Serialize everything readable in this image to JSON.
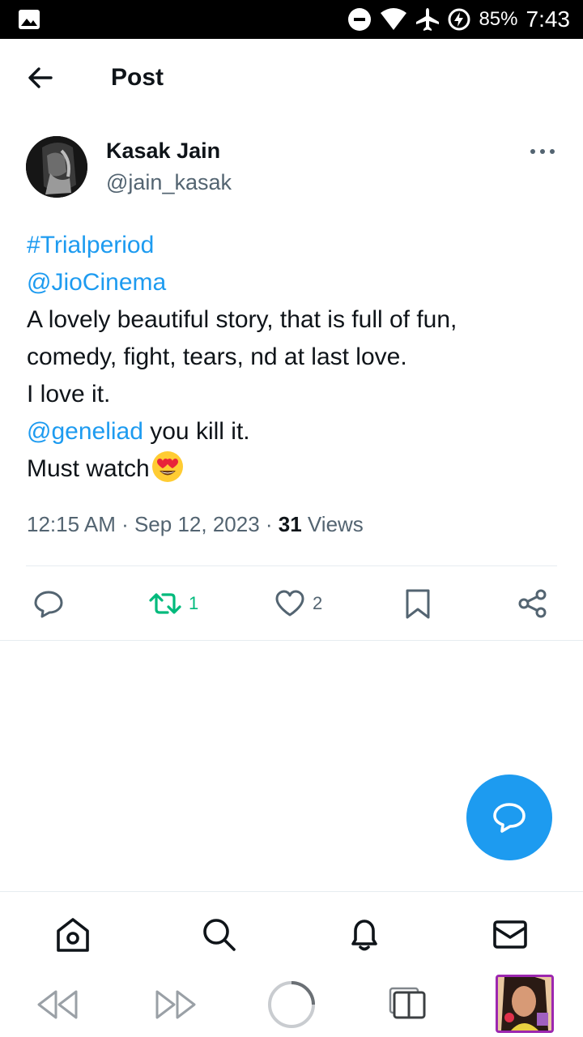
{
  "status_bar": {
    "battery": "85%",
    "time": "7:43",
    "icons": [
      "gallery-icon",
      "do-not-disturb-icon",
      "wifi-icon",
      "airplane-mode-icon",
      "battery-charging-icon"
    ]
  },
  "header": {
    "title": "Post",
    "back_icon": "arrow-left-icon"
  },
  "author": {
    "name": "Kasak Jain",
    "handle": "@jain_kasak"
  },
  "tweet": {
    "hashtag": "#Trialperiod",
    "mention1": "@JioCinema",
    "line1": "A lovely beautiful story, that is full of fun,",
    "line2": "comedy, fight, tears, nd at last love.",
    "line3": "I love it.",
    "mention2": "@geneliad",
    "line4_rest": " you kill it.",
    "line5": "Must watch",
    "emoji": "heart-eyes-emoji"
  },
  "meta": {
    "time": "12:15 AM",
    "sep": " · ",
    "date": "Sep 12, 2023",
    "views_count": "31",
    "views_label": " Views"
  },
  "actions": {
    "reply_icon": "reply-icon",
    "retweet_count": "1",
    "like_count": "2",
    "bookmark_icon": "bookmark-icon",
    "share_icon": "share-icon",
    "retweet_color": "#00ba7c"
  },
  "fab": {
    "icon": "compose-reply-icon",
    "color": "#1d9bf0"
  },
  "bottom_nav": [
    "home-icon",
    "search-icon",
    "notifications-icon",
    "messages-icon"
  ],
  "system_bar": [
    "rewind-icon",
    "fast-forward-icon",
    "loading-circle",
    "tabs-icon",
    "app-thumbnail"
  ],
  "colors": {
    "link": "#1d9bf0",
    "secondary_text": "#536471",
    "primary_text": "#0f1419"
  }
}
